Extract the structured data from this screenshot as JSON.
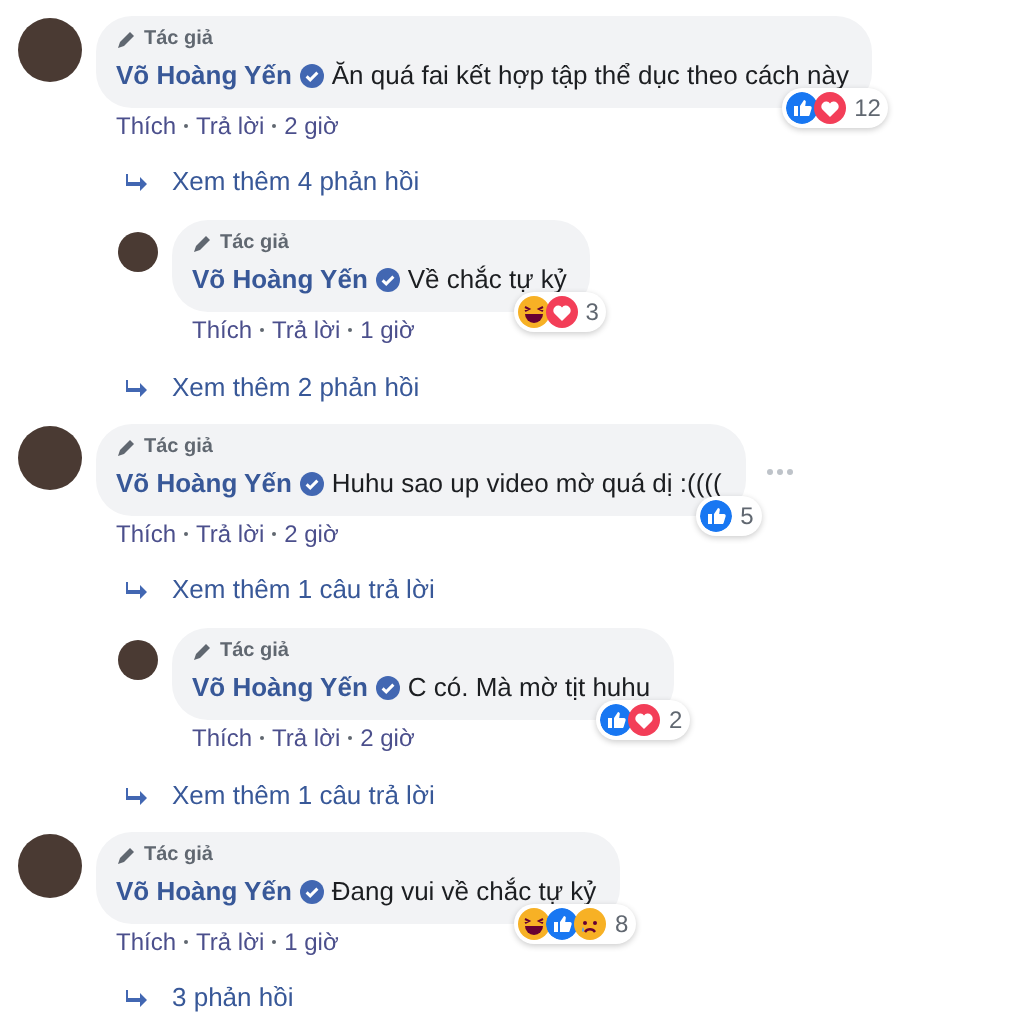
{
  "comments": [
    {
      "badge": "Tác giả",
      "author": "Võ Hoàng Yến",
      "verified": true,
      "text": "Ăn quá fai kết hợp tập thể dục theo cách này",
      "reactions": [
        {
          "kind": "like"
        },
        {
          "kind": "love"
        }
      ],
      "reaction_count": "12",
      "menu": false,
      "actions": [
        "Thích",
        "Trả lời"
      ],
      "time": "2 giờ",
      "thread": [
        {
          "kind": "more",
          "label": "Xem thêm 4 phản hồi"
        },
        {
          "kind": "reply",
          "badge": "Tác giả",
          "author": "Võ Hoàng Yến",
          "verified": true,
          "text": "Về chắc tự kỷ",
          "reactions": [
            {
              "kind": "haha"
            },
            {
              "kind": "love"
            }
          ],
          "reaction_count": "3",
          "actions": [
            "Thích",
            "Trả lời"
          ],
          "time": "1 giờ"
        },
        {
          "kind": "more",
          "label": "Xem thêm 2 phản hồi"
        }
      ]
    },
    {
      "badge": "Tác giả",
      "author": "Võ Hoàng Yến",
      "verified": true,
      "text": "Huhu sao up video mờ quá dị :((((",
      "reactions": [
        {
          "kind": "like"
        }
      ],
      "reaction_count": "5",
      "menu": true,
      "actions": [
        "Thích",
        "Trả lời"
      ],
      "time": "2 giờ",
      "thread": [
        {
          "kind": "more",
          "label": "Xem thêm 1 câu trả lời"
        },
        {
          "kind": "reply",
          "badge": "Tác giả",
          "author": "Võ Hoàng Yến",
          "verified": true,
          "text": "C có. Mà mờ tịt huhu",
          "reactions": [
            {
              "kind": "like"
            },
            {
              "kind": "love"
            }
          ],
          "reaction_count": "2",
          "actions": [
            "Thích",
            "Trả lời"
          ],
          "time": "2 giờ"
        },
        {
          "kind": "more",
          "label": "Xem thêm 1 câu trả lời"
        }
      ]
    },
    {
      "badge": "Tác giả",
      "author": "Võ Hoàng Yến",
      "verified": true,
      "text": "Đang vui về chắc tự kỷ",
      "reactions": [
        {
          "kind": "haha"
        },
        {
          "kind": "like"
        },
        {
          "kind": "sad"
        }
      ],
      "reaction_count": "8",
      "menu": false,
      "actions": [
        "Thích",
        "Trả lời"
      ],
      "time": "1 giờ",
      "thread": [
        {
          "kind": "more",
          "label": "3 phản hồi"
        }
      ]
    }
  ]
}
